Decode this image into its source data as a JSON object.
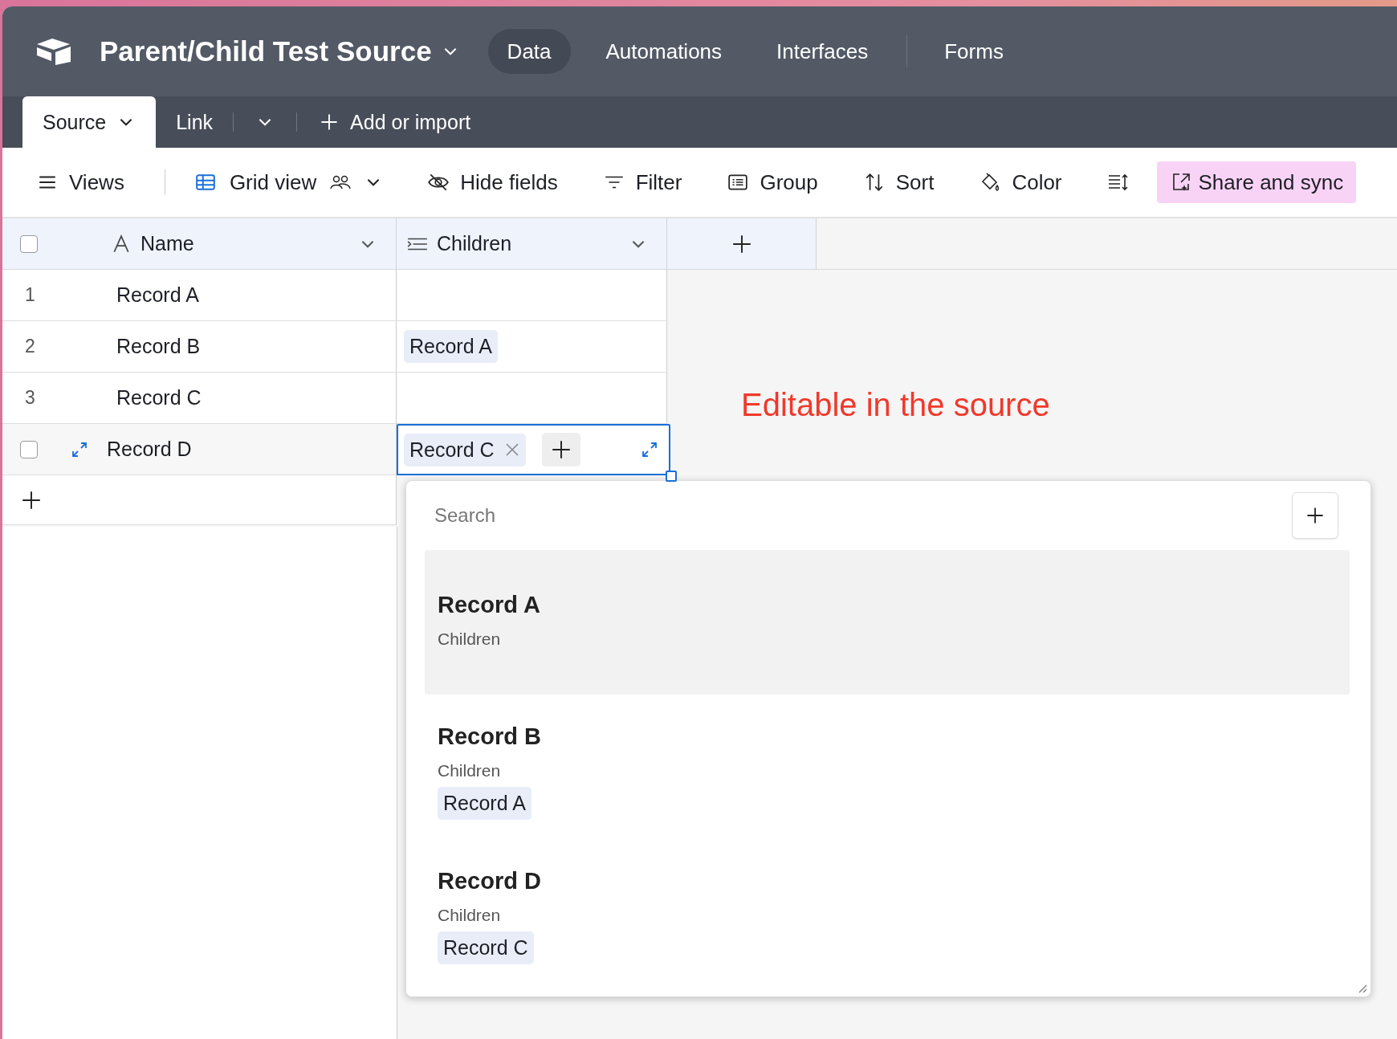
{
  "base": {
    "title": "Parent/Child Test Source"
  },
  "nav": [
    {
      "label": "Data",
      "selected": true
    },
    {
      "label": "Automations",
      "selected": false
    },
    {
      "label": "Interfaces",
      "selected": false
    },
    {
      "label": "Forms",
      "selected": false
    }
  ],
  "tables": [
    {
      "label": "Source",
      "selected": true
    },
    {
      "label": "Link",
      "selected": false
    }
  ],
  "add_table": "Add or import",
  "toolbar": {
    "views": "Views",
    "view_name": "Grid view",
    "items": [
      {
        "kind": "hide",
        "label": "Hide fields"
      },
      {
        "kind": "filter",
        "label": "Filter"
      },
      {
        "kind": "group",
        "label": "Group"
      },
      {
        "kind": "sort",
        "label": "Sort"
      },
      {
        "kind": "color",
        "label": "Color"
      },
      {
        "kind": "row-height"
      }
    ],
    "share": "Share and sync"
  },
  "grid": {
    "columns": [
      {
        "kind": "text",
        "name": "Name"
      },
      {
        "kind": "link",
        "name": "Children"
      }
    ],
    "all_selected": false,
    "rows": [
      {
        "number": "1",
        "name": "Record A",
        "hovered": false,
        "checked": false,
        "editing": false
      },
      {
        "number": "2",
        "name": "Record B",
        "children": [
          "Record A"
        ],
        "hovered": false,
        "checked": false,
        "editing": false
      },
      {
        "number": "3",
        "name": "Record C",
        "hovered": false,
        "checked": false,
        "editing": false
      },
      {
        "name": "Record D",
        "children": [
          "Record C"
        ],
        "hovered": true,
        "checked": false,
        "editing": true
      }
    ]
  },
  "annotation": "Editable in the source",
  "picker": {
    "placeholder": "Search",
    "records": [
      {
        "title": "Record A",
        "field": "Children",
        "selected": true
      },
      {
        "title": "Record B",
        "field": "Children",
        "links": [
          "Record A"
        ],
        "selected": false
      },
      {
        "title": "Record D",
        "field": "Children",
        "links": [
          "Record C"
        ],
        "selected": false
      }
    ]
  }
}
